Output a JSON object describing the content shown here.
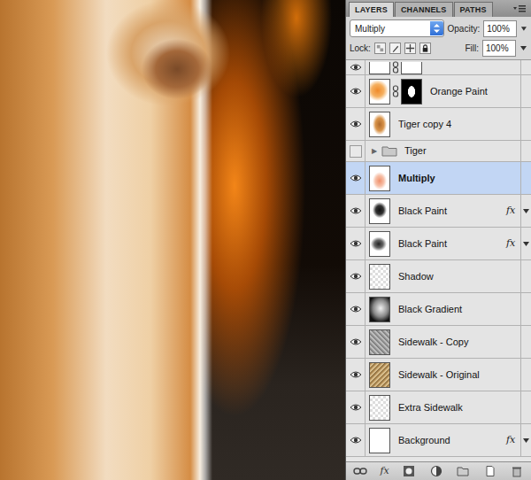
{
  "tabs": [
    {
      "label": "LAYERS",
      "selected": true
    },
    {
      "label": "CHANNELS",
      "selected": false
    },
    {
      "label": "PATHS",
      "selected": false
    }
  ],
  "blend_mode": "Multiply",
  "opacity": {
    "label": "Opacity:",
    "value": "100%"
  },
  "lock": {
    "label": "Lock:"
  },
  "fill": {
    "label": "Fill:",
    "value": "100%"
  },
  "effects_label": "fx",
  "layers": [
    {
      "kind": "masked",
      "cut": true,
      "visible": true,
      "selected": false,
      "effects": false
    },
    {
      "kind": "masked",
      "name": "Orange Paint",
      "visible": true,
      "selected": false,
      "effects": false
    },
    {
      "kind": "normal",
      "name": "Tiger copy 4",
      "visible": true,
      "selected": false,
      "effects": false
    },
    {
      "kind": "group",
      "name": "Tiger",
      "visible": false,
      "selected": false,
      "effects": false,
      "expander": "▶",
      "expanded": false
    },
    {
      "kind": "normal",
      "name": "Multiply",
      "visible": true,
      "selected": true,
      "effects": false
    },
    {
      "kind": "normal",
      "name": "Black Paint",
      "visible": true,
      "selected": false,
      "effects": true
    },
    {
      "kind": "normal",
      "name": "Black Paint",
      "visible": true,
      "selected": false,
      "effects": true
    },
    {
      "kind": "normal",
      "name": "Shadow",
      "visible": true,
      "selected": false,
      "effects": false
    },
    {
      "kind": "normal",
      "name": "Black Gradient",
      "visible": true,
      "selected": false,
      "effects": false
    },
    {
      "kind": "normal",
      "name": "Sidewalk - Copy",
      "visible": true,
      "selected": false,
      "effects": false
    },
    {
      "kind": "normal",
      "name": "Sidewalk - Original",
      "visible": true,
      "selected": false,
      "effects": false
    },
    {
      "kind": "normal",
      "name": "Extra Sidewalk",
      "visible": true,
      "selected": false,
      "effects": false
    },
    {
      "kind": "normal",
      "name": "Background",
      "visible": true,
      "selected": false,
      "effects": true
    }
  ],
  "toolbar": [
    {
      "kind": "link"
    },
    {
      "kind": "fx",
      "label": "fx"
    },
    {
      "kind": "mask"
    },
    {
      "kind": "adjustment"
    },
    {
      "kind": "group"
    },
    {
      "kind": "new"
    },
    {
      "kind": "trash"
    }
  ]
}
